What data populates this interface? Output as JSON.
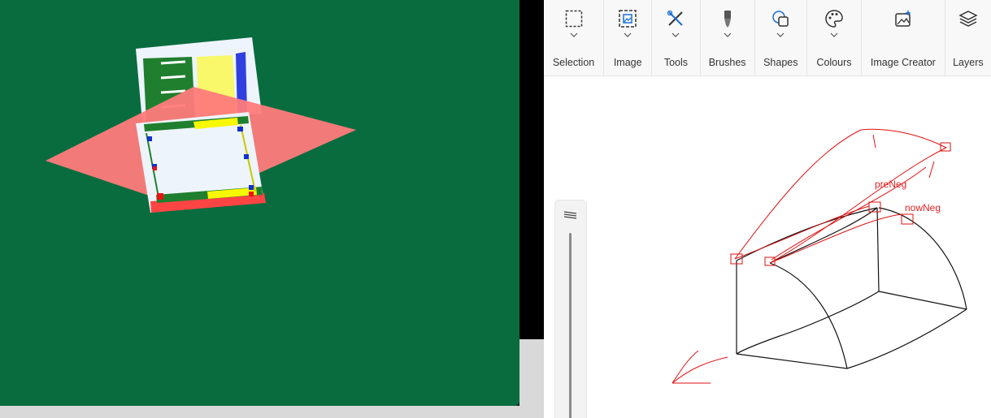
{
  "ribbon": {
    "groups": [
      {
        "label": "Selection",
        "icon": "selection-icon"
      },
      {
        "label": "Image",
        "icon": "image-icon"
      },
      {
        "label": "Tools",
        "icon": "tools-icon"
      },
      {
        "label": "Brushes",
        "icon": "brush-icon"
      },
      {
        "label": "Shapes",
        "icon": "shapes-icon"
      },
      {
        "label": "Colours",
        "icon": "palette-icon"
      },
      {
        "label": "Image Creator",
        "icon": "image-creator-icon"
      },
      {
        "label": "Layers",
        "icon": "layers-icon"
      }
    ]
  },
  "canvas": {
    "annotations": {
      "pre": "preNeg",
      "now": "nowNeg"
    }
  },
  "colors": {
    "viewport_bg": "#086c3f",
    "plane": "#ff7b7b",
    "annotation": "#e02424"
  }
}
